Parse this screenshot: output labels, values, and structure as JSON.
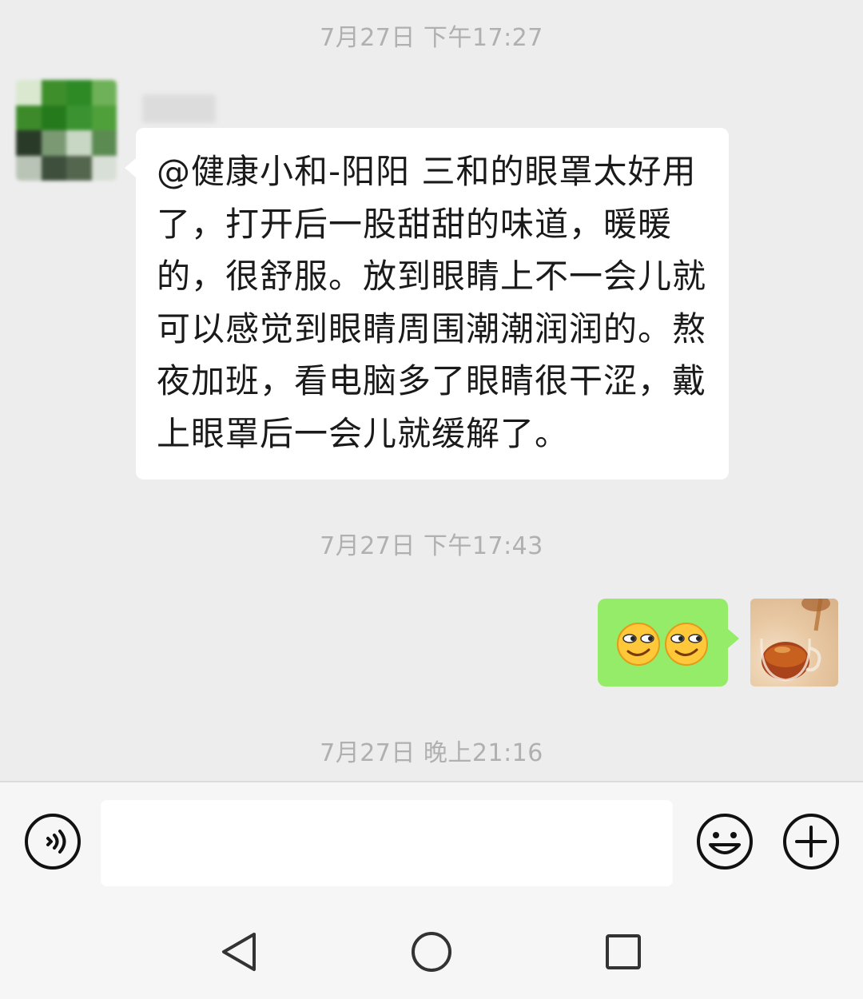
{
  "timestamps": {
    "first": "7月27日 下午17:27",
    "second": "7月27日 下午17:43",
    "third": "7月27日 晚上21:16"
  },
  "messages": {
    "incoming_text": "@健康小和-阳阳  三和的眼罩太好用了，打开后一股甜甜的味道，暖暖的，很舒服。放到眼睛上不一会儿就可以感觉到眼睛周围潮潮润润的。熬夜加班，看电脑多了眼睛很干涩，戴上眼罩后一会儿就缓解了。",
    "outgoing_emojis": [
      "smirk-emoji",
      "smirk-emoji"
    ]
  },
  "input_bar": {
    "text_value": "",
    "voice_icon": "voice-icon",
    "emoji_icon": "emoji-icon",
    "add_icon": "plus-icon"
  },
  "nav_bar": {
    "back_icon": "back-triangle-icon",
    "home_icon": "home-circle-icon",
    "recents_icon": "recents-square-icon"
  },
  "colors": {
    "background": "#ededed",
    "incoming_bubble": "#ffffff",
    "outgoing_bubble": "#95ec69",
    "timestamp_text": "#b0b0b0"
  }
}
